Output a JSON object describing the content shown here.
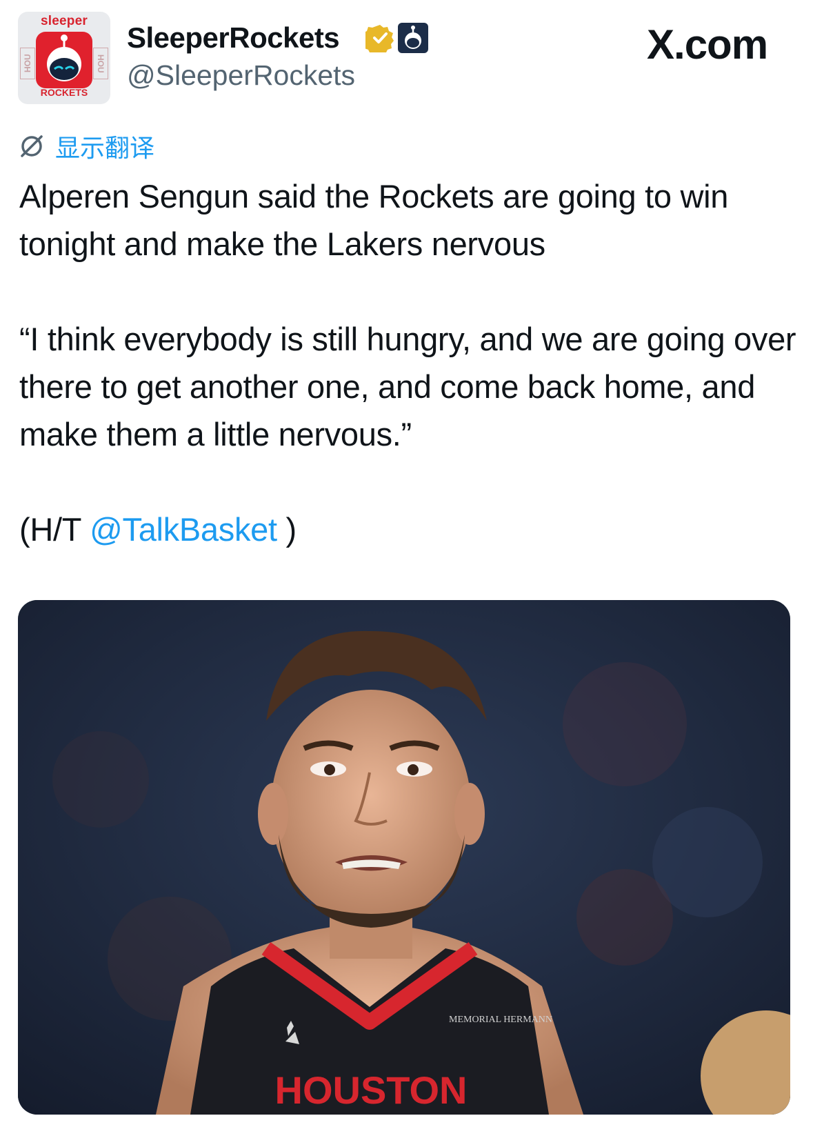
{
  "header": {
    "avatar": {
      "top_text": "sleeper",
      "side_text": "HOU",
      "bottom_text": "ROCKETS"
    },
    "display_name": "SleeperRockets",
    "handle": "@SleeperRockets",
    "site_label": "X.com"
  },
  "translate": {
    "label": "显示翻译",
    "icon": "translate-icon"
  },
  "tweet": {
    "line1": "Alperen Sengun said the Rockets are going to win tonight and make the Lakers nervous",
    "quote": "“I think everybody is still hungry, and we are going over there to get another one, and come back home, and make them a little nervous.”",
    "ht_prefix": "(H/T ",
    "ht_mention": "@TalkBasket",
    "ht_suffix": " )"
  },
  "media": {
    "jersey_sponsor": "MEMORIAL HERMANN",
    "jersey_text": "HOUSTON"
  },
  "colors": {
    "link": "#1d9bf0",
    "text": "#0f1419",
    "secondary": "#536471",
    "rockets_red": "#e0212d",
    "verified_gold": "#e8b829"
  }
}
